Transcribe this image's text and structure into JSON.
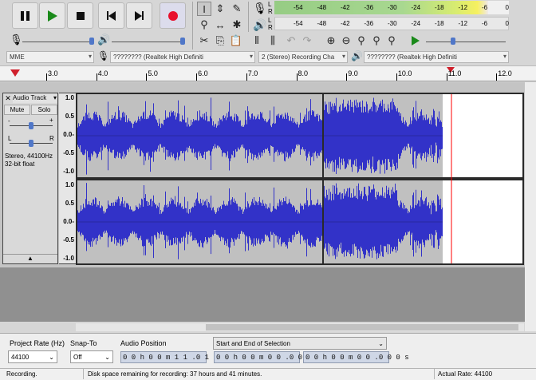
{
  "toolbar": {
    "pause_icon": "pause-icon",
    "play_icon": "play-icon",
    "stop_icon": "stop-icon",
    "skip_start_icon": "skip-to-start-icon",
    "skip_end_icon": "skip-to-end-icon",
    "record_icon": "record-icon"
  },
  "meters": {
    "record_channels": [
      "L",
      "R"
    ],
    "play_channels": [
      "L",
      "R"
    ],
    "record_ticks": [
      "-54",
      "-48",
      "-42",
      "-36",
      "-30",
      "-24",
      "-18",
      "-12",
      "-6",
      "0"
    ],
    "play_ticks": [
      "-54",
      "-48",
      "-42",
      "-36",
      "-30",
      "-24",
      "-18",
      "-12",
      "-6",
      "0"
    ]
  },
  "device": {
    "host": "MME",
    "input": "???????? (Realtek High Definiti",
    "channels": "2 (Stereo) Recording Cha",
    "output": "???????? (Realtek High Definiti"
  },
  "ruler": {
    "ticks": [
      "3.0",
      "4.0",
      "5.0",
      "6.0",
      "7.0",
      "8.0",
      "9.0",
      "10.0",
      "11.0",
      "12.0"
    ]
  },
  "track": {
    "name": "Audio Track",
    "mute_label": "Mute",
    "solo_label": "Solo",
    "gain_min": "-",
    "gain_max": "+",
    "pan_left": "L",
    "pan_right": "R",
    "info_line1": "Stereo, 44100Hz",
    "info_line2": "32-bit float",
    "amp_labels": [
      "1.0",
      "0.5",
      "0.0-",
      "-0.5",
      "-1.0"
    ]
  },
  "selection_bar": {
    "project_rate_label": "Project Rate (Hz)",
    "project_rate_value": "44100",
    "snap_label": "Snap-To",
    "snap_value": "Off",
    "audio_position_label": "Audio Position",
    "audio_position_value": "0 0 h 0 0 m 1 1 .0 1 5 s",
    "selection_label": "Start and End of Selection",
    "selection_start": "0 0 h 0 0 m 0 0 .0 0 0 s",
    "selection_end": "0 0 h 0 0 m 0 0 .0 0 0 s"
  },
  "status": {
    "state": "Recording.",
    "disk": "Disk space remaining for recording: 37 hours and 41 minutes.",
    "rate": "Actual Rate: 44100"
  },
  "colors": {
    "wave": "#3232c8",
    "bg_unselected": "#c0c0c0",
    "playhead": "#ff0000"
  }
}
